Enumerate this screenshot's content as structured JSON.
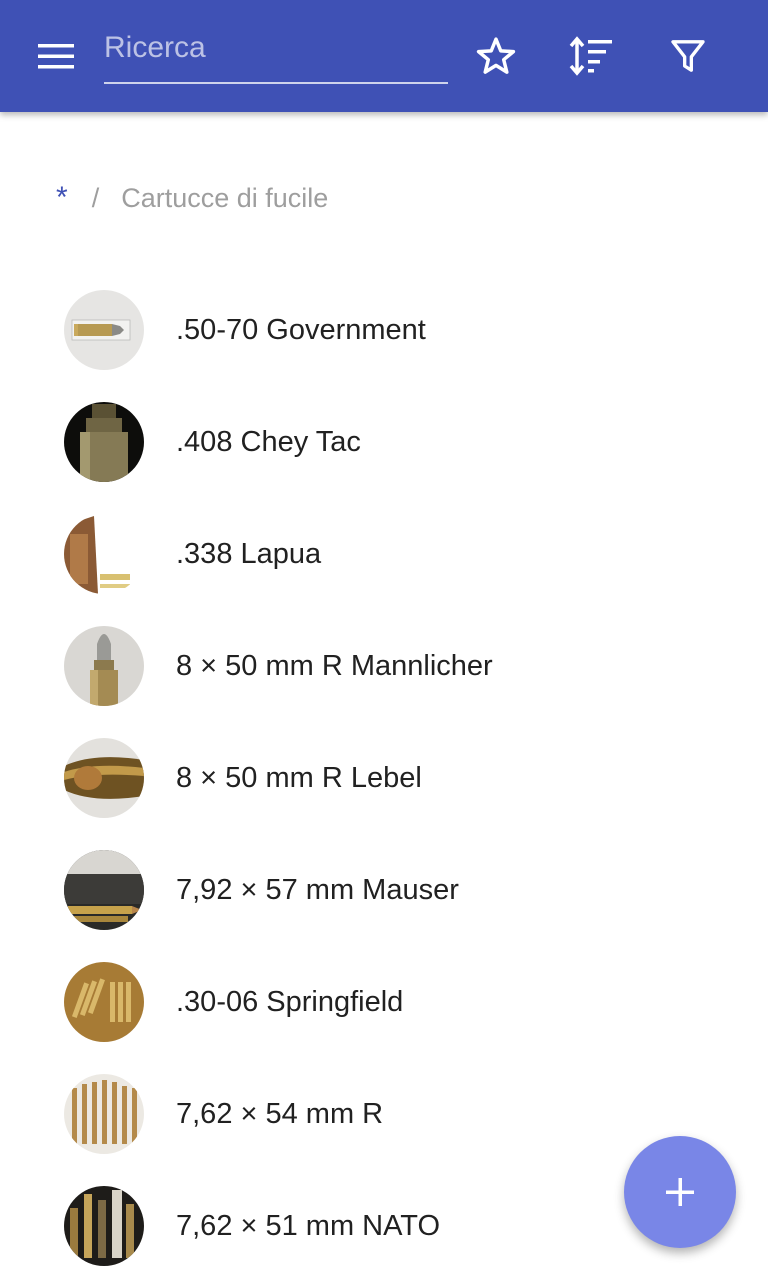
{
  "appbar": {
    "menu_icon": "menu-icon",
    "search_placeholder": "Ricerca",
    "search_value": "",
    "actions": [
      "star-icon",
      "sort-icon",
      "filter-icon"
    ],
    "color": "#3f51b5"
  },
  "breadcrumb": {
    "root": "*",
    "separator": "/",
    "current": "Cartucce di fucile"
  },
  "items": [
    {
      "label": ".50-70 Government"
    },
    {
      "label": ".408 Chey Tac"
    },
    {
      "label": ".338 Lapua"
    },
    {
      "label": "8 × 50 mm R Mannlicher"
    },
    {
      "label": "8 × 50 mm R Lebel"
    },
    {
      "label": "7,92 × 57 mm Mauser"
    },
    {
      "label": ".30-06 Springfield"
    },
    {
      "label": "7,62 × 54 mm R"
    },
    {
      "label": "7,62 × 51 mm NATO"
    }
  ],
  "fab": {
    "icon": "plus-icon",
    "color": "#7986e7"
  }
}
